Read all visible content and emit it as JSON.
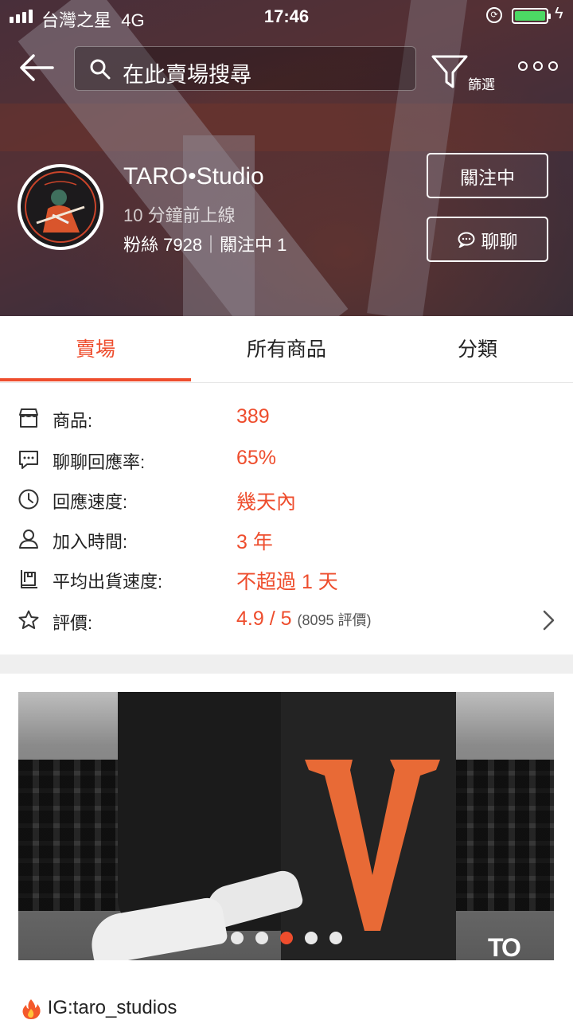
{
  "status_bar": {
    "carrier": "台灣之星",
    "network": "4G",
    "time": "17:46",
    "battery_color": "#4cd964"
  },
  "header": {
    "search_placeholder": "在此賣場搜尋",
    "filter_label": "篩選"
  },
  "shop": {
    "name": "TARO•Studio",
    "last_online": "10 分鐘前上線",
    "stats": "粉絲 7928｜關注中 1",
    "follow_button": "關注中",
    "chat_button": "聊聊"
  },
  "tabs": [
    {
      "label": "賣場",
      "active": true
    },
    {
      "label": "所有商品",
      "active": false
    },
    {
      "label": "分類",
      "active": false
    }
  ],
  "info": {
    "products": {
      "label": "商品:",
      "value": "389",
      "icon": "shop-icon"
    },
    "chat_rate": {
      "label": "聊聊回應率:",
      "value": "65%",
      "icon": "chat-icon"
    },
    "response_speed": {
      "label": "回應速度:",
      "value": "幾天內",
      "icon": "clock-icon"
    },
    "joined": {
      "label": "加入時間:",
      "value": "3 年",
      "icon": "user-icon"
    },
    "shipping": {
      "label": "平均出貨速度:",
      "value": "不超過 1 天",
      "icon": "shipping-icon"
    },
    "rating": {
      "label": "評價:",
      "value": "4.9 / 5",
      "count": "(8095 評價)",
      "icon": "star-icon"
    }
  },
  "banner": {
    "brand_mark": "TO",
    "slide_count": 5,
    "active_slide": 3
  },
  "description": {
    "text": "IG:taro_studios"
  },
  "colors": {
    "accent": "#ee4d2d"
  }
}
